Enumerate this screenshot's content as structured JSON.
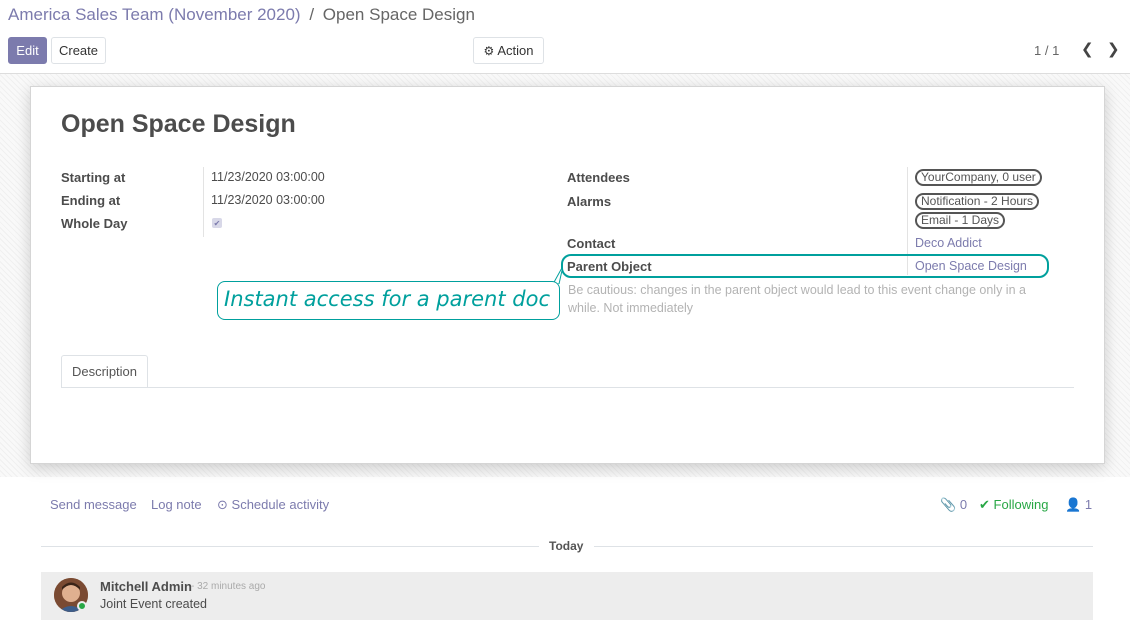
{
  "breadcrumb": {
    "parent": "America Sales Team (November 2020)",
    "separator": "/",
    "current": "Open Space Design"
  },
  "buttons": {
    "edit": "Edit",
    "create": "Create",
    "action": "Action"
  },
  "pager": {
    "value": "1 / 1"
  },
  "record": {
    "title": "Open Space Design",
    "left_fields": [
      {
        "label": "Starting at",
        "value": "11/23/2020 03:00:00"
      },
      {
        "label": "Ending at",
        "value": "11/23/2020 03:00:00"
      },
      {
        "label": "Whole Day",
        "checked": true
      }
    ],
    "attendees_label": "Attendees",
    "attendees": [
      "YourCompany, 0 user"
    ],
    "alarms_label": "Alarms",
    "alarms": [
      "Notification - 2 Hours",
      "Email - 1 Days"
    ],
    "contact_label": "Contact",
    "contact_value": "Deco Addict",
    "parent_label": "Parent Object",
    "parent_value": "Open Space Design",
    "help_text": "Be cautious: changes in the parent object would lead to this event change only in a while. Not immediately"
  },
  "annotation": {
    "text": "Instant access for a parent doc",
    "color": "#00a09d"
  },
  "tabs": [
    "Description"
  ],
  "chatter": {
    "send_message": "Send message",
    "log_note": "Log note",
    "schedule_activity": "Schedule activity",
    "attachments_count": "0",
    "following": "Following",
    "followers_count": "1",
    "date_separator": "Today",
    "messages": [
      {
        "author": "Mitchell Admin",
        "time": "- 32 minutes ago",
        "body": "Joint Event created"
      }
    ]
  },
  "colors": {
    "brand": "#7c7bad",
    "accent": "#00a09d",
    "following": "#28a745"
  }
}
